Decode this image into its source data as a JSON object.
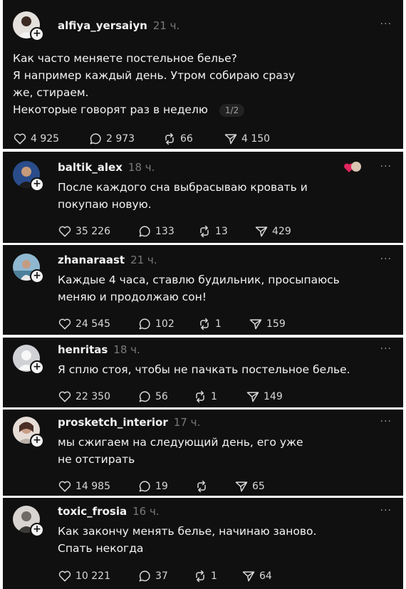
{
  "posts": [
    {
      "username": "alfiya_yersaiyn",
      "time": "21 ч.",
      "lines": [
        "Как часто меняете постельное белье?",
        "Я например каждый день. Утром собираю сразу",
        "же, стираем.",
        "Некоторые говорят раз в неделю"
      ],
      "pager": "1/2",
      "likes": "4 925",
      "comments": "2 973",
      "reposts": "66",
      "shares": "4 150",
      "avatar_color": "#d9d4cf"
    },
    {
      "username": "baltik_alex",
      "time": "18 ч.",
      "lines": [
        "После каждого сна выбрасываю кровать и",
        "покупаю новую."
      ],
      "likes": "35 226",
      "comments": "133",
      "reposts": "13",
      "shares": "429",
      "avatar_color": "#2a4c8a"
    },
    {
      "username": "zhanaraast",
      "time": "21 ч.",
      "lines": [
        "Каждые 4 часа, ставлю будильник, просыпаюсь",
        "меняю и продолжаю сон!"
      ],
      "likes": "24 545",
      "comments": "102",
      "reposts": "1",
      "shares": "159",
      "avatar_color": "#7aa8c4"
    },
    {
      "username": "henritas",
      "time": "18 ч.",
      "lines": [
        "Я сплю стоя, чтобы не пачкать постельное белье."
      ],
      "likes": "22 350",
      "comments": "56",
      "reposts": "1",
      "shares": "149",
      "avatar_color": "#cfd1d5"
    },
    {
      "username": "prosketch_interior",
      "time": "17 ч.",
      "lines": [
        "мы сжигаем на следующий день, его уже",
        "не отстирать"
      ],
      "likes": "14 985",
      "comments": "19",
      "reposts": "",
      "shares": "65",
      "avatar_color": "#c9a99a"
    },
    {
      "username": "toxic_frosia",
      "time": "16 ч.",
      "lines": [
        "Как закончу менять белье, начинаю заново.",
        "Спать некогда"
      ],
      "likes": "10 221",
      "comments": "37",
      "reposts": "1",
      "shares": "64",
      "avatar_color": "#6f6a66"
    }
  ],
  "more_label": "···",
  "plus_label": "+",
  "colors": {
    "background": "#101010",
    "separator": "#ffffff",
    "text": "#f3f3f3",
    "muted": "#7a7a7a"
  }
}
